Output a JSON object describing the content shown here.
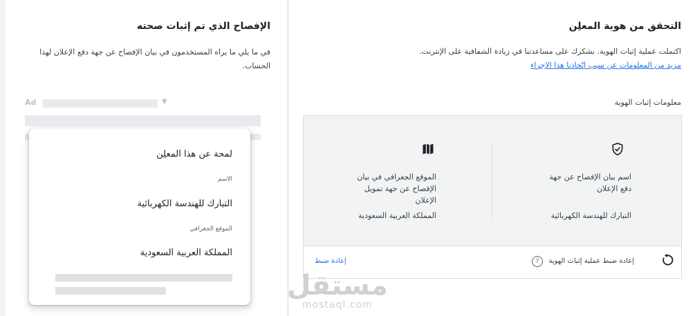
{
  "verification": {
    "title": "التحقق من هوية المعلِن",
    "description": "اكتملت عملية إثبات الهوية. نشكرك على مساعدتنا في زيادة الشفافية على الإنترنت.",
    "link": "مزيد من المعلومات عن سبب اتّخاذنا هذا الإجراء",
    "section_label": "معلومات إثبات الهوية",
    "card": {
      "name_label": "اسم بيان الإفصاح عن جهة دفع الإعلان",
      "name_value": "التبارك للهندسة الكهربائية",
      "name_icon": "verified-shield-icon",
      "location_label": "الموقع الجغرافي في بيان الإفصاح عن جهة تمويل الإعلان",
      "location_value": "المملكة العربية السعودية",
      "location_icon": "map-icon",
      "footer_reset": "إعادة ضبط عملية إثبات الهوية",
      "footer_help": "?",
      "footer_link": "إعادة ضبط"
    }
  },
  "disclosure": {
    "title": "الإفصاح الذي تم إثبات صحته",
    "description": "في ما يلي ما يراه المستخدمون في بيان الإفصاح عن جهة دفع الإعلان لهذا الحساب.",
    "ad_label": "Ad",
    "popup": {
      "title": "لمحة عن هذا المعلِن",
      "name_label": "الاسم",
      "name_value": "التبارك للهندسة الكهربائية",
      "location_label": "الموقع الجغرافي",
      "location_value": "المملكة العربية السعودية"
    }
  },
  "watermark": {
    "arabic": "مستقل",
    "latin": "mostaql.com"
  }
}
